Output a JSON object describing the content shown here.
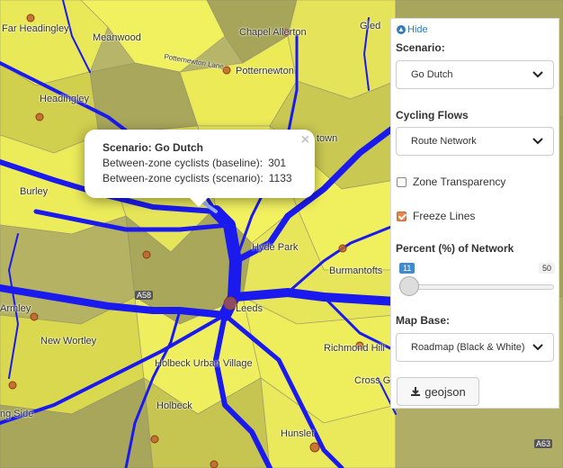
{
  "map": {
    "places": [
      {
        "id": "far-headingley",
        "text": "Far Headingley"
      },
      {
        "id": "meanwood",
        "text": "Meanwood"
      },
      {
        "id": "chapel-allerton",
        "text": "Chapel Allerton"
      },
      {
        "id": "potternewton",
        "text": "Potternewton"
      },
      {
        "id": "potternewton-lane",
        "text": "Potternewton Lane"
      },
      {
        "id": "headingley",
        "text": "Headingley"
      },
      {
        "id": "burley",
        "text": "Burley"
      },
      {
        "id": "town",
        "text": "town"
      },
      {
        "id": "hyde-park",
        "text": "Hyde Park"
      },
      {
        "id": "burmantofts",
        "text": "Burmantofts"
      },
      {
        "id": "armley",
        "text": "Armley"
      },
      {
        "id": "leeds",
        "text": "Leeds"
      },
      {
        "id": "new-wortley",
        "text": "New Wortley"
      },
      {
        "id": "richmond-hill",
        "text": "Richmond Hill"
      },
      {
        "id": "holbeck-urban-village",
        "text": "Holbeck Urban Village"
      },
      {
        "id": "cross-gates",
        "text": "Cross Ga"
      },
      {
        "id": "holbeck",
        "text": "Holbeck"
      },
      {
        "id": "ng-side",
        "text": "ng Side"
      },
      {
        "id": "hunslet",
        "text": "Hunslet"
      },
      {
        "id": "a63",
        "text": "A63"
      },
      {
        "id": "a58",
        "text": "A58"
      },
      {
        "id": "gledhow",
        "text": "Gled"
      }
    ]
  },
  "popup": {
    "title": "Scenario: Go Dutch",
    "rows": [
      {
        "label": "Between-zone cyclists (baseline):",
        "value": "301"
      },
      {
        "label": "Between-zone cyclists (scenario):",
        "value": "1133"
      }
    ],
    "close": "×"
  },
  "panel": {
    "hide_label": "Hide",
    "scenario_label": "Scenario:",
    "scenario_value": "Go Dutch",
    "flows_label": "Cycling Flows",
    "flows_value": "Route Network",
    "zone_transparency_label": "Zone Transparency",
    "zone_transparency_checked": false,
    "freeze_lines_label": "Freeze Lines",
    "freeze_lines_checked": true,
    "percent_label": "Percent (%) of Network",
    "slider_min_badge": "11",
    "slider_max_badge": "50",
    "slider_value": 11,
    "map_base_label": "Map Base:",
    "map_base_value": "Roadmap (Black & White)",
    "geojson_button": "geojson"
  },
  "colors": {
    "zone_bright": "#f1f05e",
    "zone_mid": "#d6d44c",
    "zone_olive": "#a9a856",
    "route_blue": "#1a1aee",
    "checkbox_accent": "#e8854a"
  }
}
